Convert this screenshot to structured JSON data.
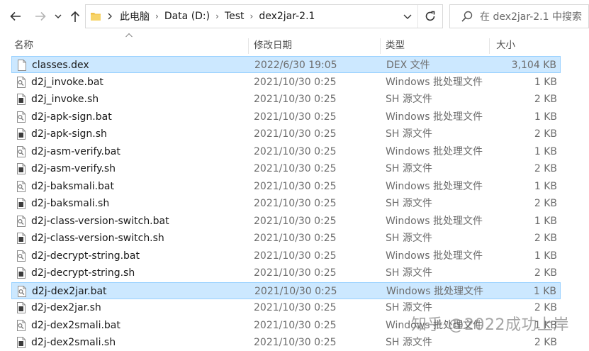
{
  "address_bar": {
    "breadcrumbs": [
      "此电脑",
      "Data (D:)",
      "Test",
      "dex2jar-2.1"
    ]
  },
  "search": {
    "placeholder": "在 dex2jar-2.1 中搜索"
  },
  "columns": {
    "name": "名称",
    "modified": "修改日期",
    "type": "类型",
    "size": "大小"
  },
  "files": [
    {
      "name": "classes.dex",
      "modified": "2022/6/30 19:05",
      "type": "DEX 文件",
      "size": "3,104 KB",
      "icon": "blank-file-icon",
      "selected": true
    },
    {
      "name": "d2j_invoke.bat",
      "modified": "2021/10/30 0:25",
      "type": "Windows 批处理文件",
      "size": "1 KB",
      "icon": "batch-file-icon",
      "selected": false
    },
    {
      "name": "d2j_invoke.sh",
      "modified": "2021/10/30 0:25",
      "type": "SH 源文件",
      "size": "2 KB",
      "icon": "script-file-icon",
      "selected": false
    },
    {
      "name": "d2j-apk-sign.bat",
      "modified": "2021/10/30 0:25",
      "type": "Windows 批处理文件",
      "size": "1 KB",
      "icon": "batch-file-icon",
      "selected": false
    },
    {
      "name": "d2j-apk-sign.sh",
      "modified": "2021/10/30 0:25",
      "type": "SH 源文件",
      "size": "2 KB",
      "icon": "script-file-icon",
      "selected": false
    },
    {
      "name": "d2j-asm-verify.bat",
      "modified": "2021/10/30 0:25",
      "type": "Windows 批处理文件",
      "size": "1 KB",
      "icon": "batch-file-icon",
      "selected": false
    },
    {
      "name": "d2j-asm-verify.sh",
      "modified": "2021/10/30 0:25",
      "type": "SH 源文件",
      "size": "2 KB",
      "icon": "script-file-icon",
      "selected": false
    },
    {
      "name": "d2j-baksmali.bat",
      "modified": "2021/10/30 0:25",
      "type": "Windows 批处理文件",
      "size": "1 KB",
      "icon": "batch-file-icon",
      "selected": false
    },
    {
      "name": "d2j-baksmali.sh",
      "modified": "2021/10/30 0:25",
      "type": "SH 源文件",
      "size": "2 KB",
      "icon": "script-file-icon",
      "selected": false
    },
    {
      "name": "d2j-class-version-switch.bat",
      "modified": "2021/10/30 0:25",
      "type": "Windows 批处理文件",
      "size": "1 KB",
      "icon": "batch-file-icon",
      "selected": false
    },
    {
      "name": "d2j-class-version-switch.sh",
      "modified": "2021/10/30 0:25",
      "type": "SH 源文件",
      "size": "2 KB",
      "icon": "script-file-icon",
      "selected": false
    },
    {
      "name": "d2j-decrypt-string.bat",
      "modified": "2021/10/30 0:25",
      "type": "Windows 批处理文件",
      "size": "1 KB",
      "icon": "batch-file-icon",
      "selected": false
    },
    {
      "name": "d2j-decrypt-string.sh",
      "modified": "2021/10/30 0:25",
      "type": "SH 源文件",
      "size": "2 KB",
      "icon": "script-file-icon",
      "selected": false
    },
    {
      "name": "d2j-dex2jar.bat",
      "modified": "2021/10/30 0:25",
      "type": "Windows 批处理文件",
      "size": "1 KB",
      "icon": "batch-file-icon",
      "selected": true
    },
    {
      "name": "d2j-dex2jar.sh",
      "modified": "2021/10/30 0:25",
      "type": "SH 源文件",
      "size": "2 KB",
      "icon": "script-file-icon",
      "selected": false
    },
    {
      "name": "d2j-dex2smali.bat",
      "modified": "2021/10/30 0:25",
      "type": "Windows 批处理文件",
      "size": "1 KB",
      "icon": "batch-file-icon",
      "selected": false
    },
    {
      "name": "d2j-dex2smali.sh",
      "modified": "2021/10/30 0:25",
      "type": "SH 源文件",
      "size": "2 KB",
      "icon": "script-file-icon",
      "selected": false
    }
  ],
  "watermark": "知乎 @2022成功上岸",
  "colors": {
    "selection_bg": "#cce8ff",
    "selection_border": "#99d1ff",
    "folder": "#f0c24b"
  }
}
